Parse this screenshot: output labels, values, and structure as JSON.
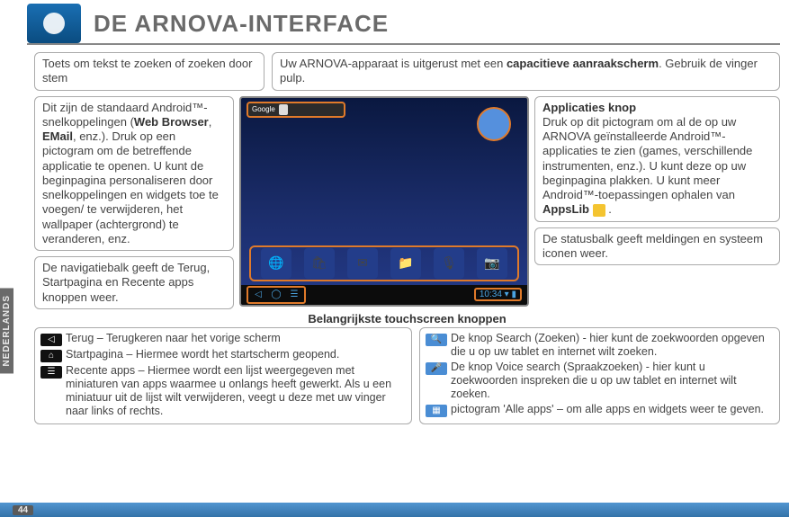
{
  "header": {
    "title": "DE ARNOVA-INTERFACE"
  },
  "sideTab": "NEDERLANDS",
  "topRow": {
    "left": "Toets om tekst te zoeken of zoeken door stem",
    "right_a": "Uw ARNOVA-apparaat is uitgerust met een ",
    "right_bold": "capacitieve aanraakscherm",
    "right_b": ". Gebruik de vinger pulp."
  },
  "leftCol": {
    "box1_a": "Dit zijn de standaard Android™-snelkoppelingen (",
    "box1_b1": "Web Browser",
    "box1_c": ", ",
    "box1_b2": "EMail",
    "box1_d": ", enz.). Druk op een pictogram om de betreffende applicatie te openen. U kunt de beginpagina personaliseren door snelkoppelingen en widgets toe te voegen/ te verwijderen, het wallpaper (achtergrond) te veranderen, enz.",
    "box2": "De navigatiebalk geeft de Terug, Startpagina en Recente apps knoppen weer."
  },
  "rightCol": {
    "box1_title": "Applicaties knop",
    "box1_body_a": "Druk op dit pictogram om al de op uw ARNOVA geïnstalleerde Android™-applicaties te zien (games, verschillende instrumenten, enz.). U kunt deze op uw beginpagina plakken. U kunt meer Android™-toepassingen ophalen van ",
    "box1_body_bold": "AppsLib",
    "box1_body_b": " .",
    "box2": "De statusbalk geeft meldingen en systeem iconen weer."
  },
  "screenshot": {
    "search_label": "Google",
    "clock": "10:34",
    "apps": [
      "Browser",
      "AppsLib",
      "Email",
      "Files",
      "Sound Rec",
      "Camera"
    ]
  },
  "subheading": "Belangrijkste touchscreen knoppen",
  "bottomLeft": [
    {
      "icon": "back",
      "text": "Terug – Terugkeren naar het vorige scherm"
    },
    {
      "icon": "home",
      "text": "Startpagina – Hiermee wordt het startscherm geopend."
    },
    {
      "icon": "recent",
      "text": "Recente apps – Hiermee wordt een lijst weergegeven met miniaturen van apps waarmee u onlangs heeft gewerkt. Als u een miniatuur uit de lijst wilt verwijderen, veegt u deze met uw vinger naar links of rechts."
    }
  ],
  "bottomRight": [
    {
      "icon": "search",
      "text": "De knop Search (Zoeken) - hier kunt de zoekwoorden opgeven die u op uw tablet en internet wilt zoeken."
    },
    {
      "icon": "voice",
      "text": "De knop Voice search (Spraakzoeken) - hier kunt u zoekwoorden inspreken die u op uw tablet en internet wilt zoeken."
    },
    {
      "icon": "apps",
      "text": "pictogram 'Alle apps' – om alle apps en widgets weer te geven."
    }
  ],
  "pageNumber": "44"
}
